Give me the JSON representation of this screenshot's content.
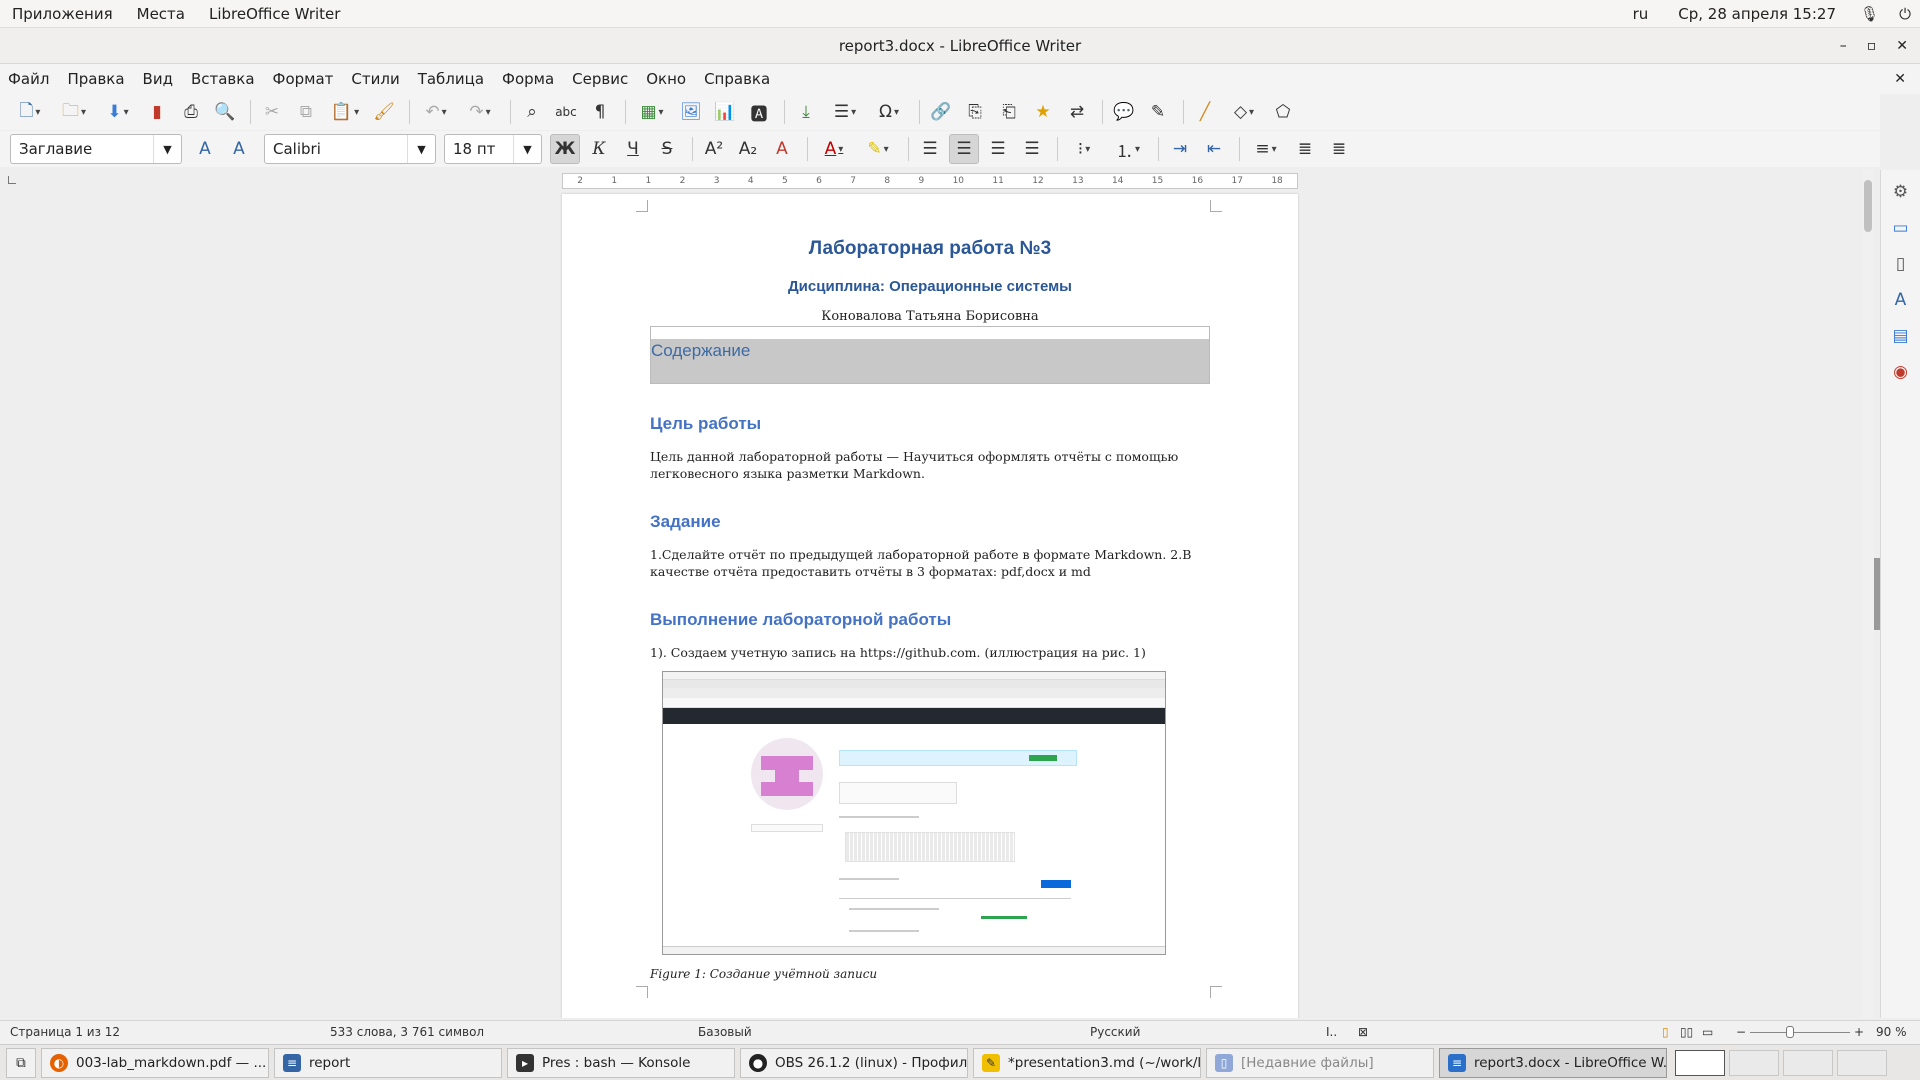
{
  "system": {
    "apps": "Приложения",
    "places": "Места",
    "active_app": "LibreOffice Writer",
    "lang": "ru",
    "datetime": "Ср, 28 апреля  15:27"
  },
  "window": {
    "title": "report3.docx - LibreOffice Writer"
  },
  "menu": [
    "Файл",
    "Правка",
    "Вид",
    "Вставка",
    "Формат",
    "Стили",
    "Таблица",
    "Форма",
    "Сервис",
    "Окно",
    "Справка"
  ],
  "formatting": {
    "paragraph_style": "Заглавие",
    "font_name": "Calibri",
    "font_size": "18 пт"
  },
  "ruler": [
    "2",
    "1",
    "1",
    "2",
    "3",
    "4",
    "5",
    "6",
    "7",
    "8",
    "9",
    "10",
    "11",
    "12",
    "13",
    "14",
    "15",
    "16",
    "17",
    "18"
  ],
  "document": {
    "title": "Лабораторная работа №3",
    "subtitle": "Дисциплина: Операционные системы",
    "author": "Коновалова Татьяна Борисовна",
    "toc_label": "Содержание",
    "h_goal": "Цель работы",
    "goal_text": "Цель данной лабораторной работы — Научиться оформлять отчёты с помощью легковесного языка разметки Markdown.",
    "h_task": "Задание",
    "task_text": "1.Сделайте отчёт по предыдущей лабораторной работе в формате Markdown. 2.В качестве отчёта предоставить отчёты в 3 форматах: pdf,docx и md",
    "h_exec": "Выполнение лабораторной работы",
    "exec_text": "1). Создаем учетную запись на https://github.com. (иллюстрация на рис. 1)",
    "figure_caption": "Figure 1: Создание учётной записи"
  },
  "status": {
    "page": "Страница 1 из 12",
    "words": "533 слова, 3 761 символ",
    "style": "Базовый",
    "language": "Русский",
    "zoom": "90 %"
  },
  "taskbar": [
    {
      "label": "003-lab_markdown.pdf — ...",
      "icon_color": "#e66000"
    },
    {
      "label": "report",
      "icon_color": "#3465a4"
    },
    {
      "label": "Pres : bash — Konsole",
      "icon_color": "#333333"
    },
    {
      "label": "OBS 26.1.2 (linux) - Профил...",
      "icon_color": "#222222"
    },
    {
      "label": "*presentation3.md (~/work/l...",
      "icon_color": "#f0c000"
    },
    {
      "label": "[Недавние файлы]",
      "icon_color": "#8fa8d8"
    },
    {
      "label": "report3.docx - LibreOffice W...",
      "icon_color": "#2a6fc9"
    }
  ],
  "colors": {
    "heading": "#2b5797",
    "heading2": "#4472c4",
    "toc_bg": "#c8c8c8"
  }
}
